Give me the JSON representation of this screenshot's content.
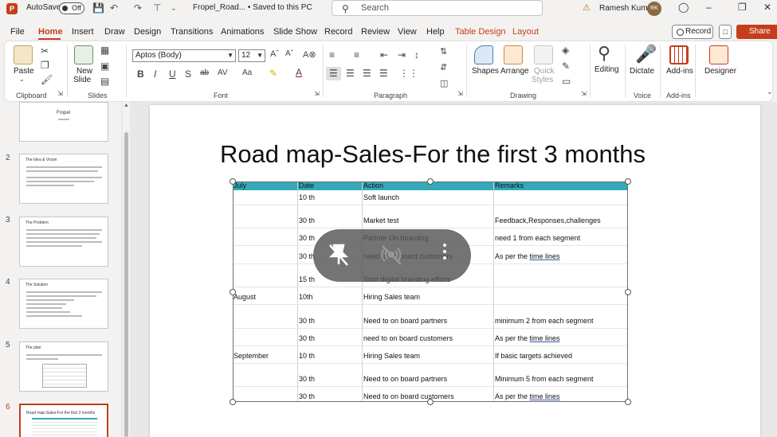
{
  "titlebar": {
    "app_logo": "P",
    "autosave_label": "AutoSave",
    "autosave_state": "Off",
    "filename": "Fropel_Road... • Saved to this PC",
    "search_placeholder": "Search",
    "user_name": "Ramesh Kumar",
    "user_initials": "RK"
  },
  "menu": {
    "tabs": [
      "File",
      "Home",
      "Insert",
      "Draw",
      "Design",
      "Transitions",
      "Animations",
      "Slide Show",
      "Record",
      "Review",
      "View",
      "Help",
      "Table Design",
      "Layout"
    ],
    "active_tab": "Home",
    "record_label": "Record",
    "share_label": "Share"
  },
  "ribbon": {
    "clipboard": {
      "paste": "Paste",
      "group": "Clipboard"
    },
    "slides": {
      "new_slide_line1": "New",
      "new_slide_line2": "Slide",
      "group": "Slides"
    },
    "font": {
      "name": "Aptos (Body)",
      "size": "12",
      "group": "Font"
    },
    "paragraph": {
      "group": "Paragraph"
    },
    "drawing": {
      "shapes": "Shapes",
      "arrange": "Arrange",
      "quick_styles_line1": "Quick",
      "quick_styles_line2": "Styles",
      "group": "Drawing"
    },
    "editing": {
      "label": "Editing"
    },
    "voice": {
      "dictate": "Dictate",
      "group": "Voice"
    },
    "addins": {
      "label": "Add-ins",
      "group": "Add-ins"
    },
    "designer": {
      "label": "Designer"
    }
  },
  "thumbnails": [
    {
      "num": "",
      "title": "Fropel"
    },
    {
      "num": "2",
      "title": "The Idea & Vision"
    },
    {
      "num": "3",
      "title": "The Problem"
    },
    {
      "num": "4",
      "title": "The Solution"
    },
    {
      "num": "5",
      "title": "The plan"
    },
    {
      "num": "6",
      "title": "Road map-Sales-For the first 3 months"
    }
  ],
  "slide": {
    "title": "Road map-Sales-For the first 3 months",
    "table": {
      "headers": [
        "July",
        "Date",
        "Action",
        "Remarks"
      ],
      "rows": [
        [
          "",
          "10 th",
          "Soft launch",
          ""
        ],
        [
          "",
          "30 th",
          "Market test",
          "Feedback,Responses,challenges"
        ],
        [
          "",
          "30 th",
          "Partner On boarding",
          "need 1 from each segment"
        ],
        [
          "",
          "30 th",
          "need to on board customers",
          "As per the time lines"
        ],
        [
          "",
          "15 th",
          "Start digital branding efforts",
          ""
        ],
        [
          "August",
          "10th",
          "Hiring Sales team",
          ""
        ],
        [
          "",
          "30 th",
          "Need to on board partners",
          "minimum 2 from each segment"
        ],
        [
          "",
          "30 th",
          "need to on board customers",
          "As per the time lines"
        ],
        [
          "September",
          "10 th",
          "Hiring Sales team",
          "If basic targets achieved"
        ],
        [
          "",
          "30 th",
          "Need to on board partners",
          "Minimum 5 from each segment"
        ],
        [
          "",
          "30 th",
          "Need to on board customers",
          "As per the time lines"
        ]
      ]
    }
  },
  "overlay": {
    "unpin_icon": "unpin-icon",
    "mute_icon": "mute-icon",
    "more_icon": "more-options-icon"
  },
  "colors": {
    "accent": "#c43e1c",
    "table_header": "#33a9b9"
  }
}
